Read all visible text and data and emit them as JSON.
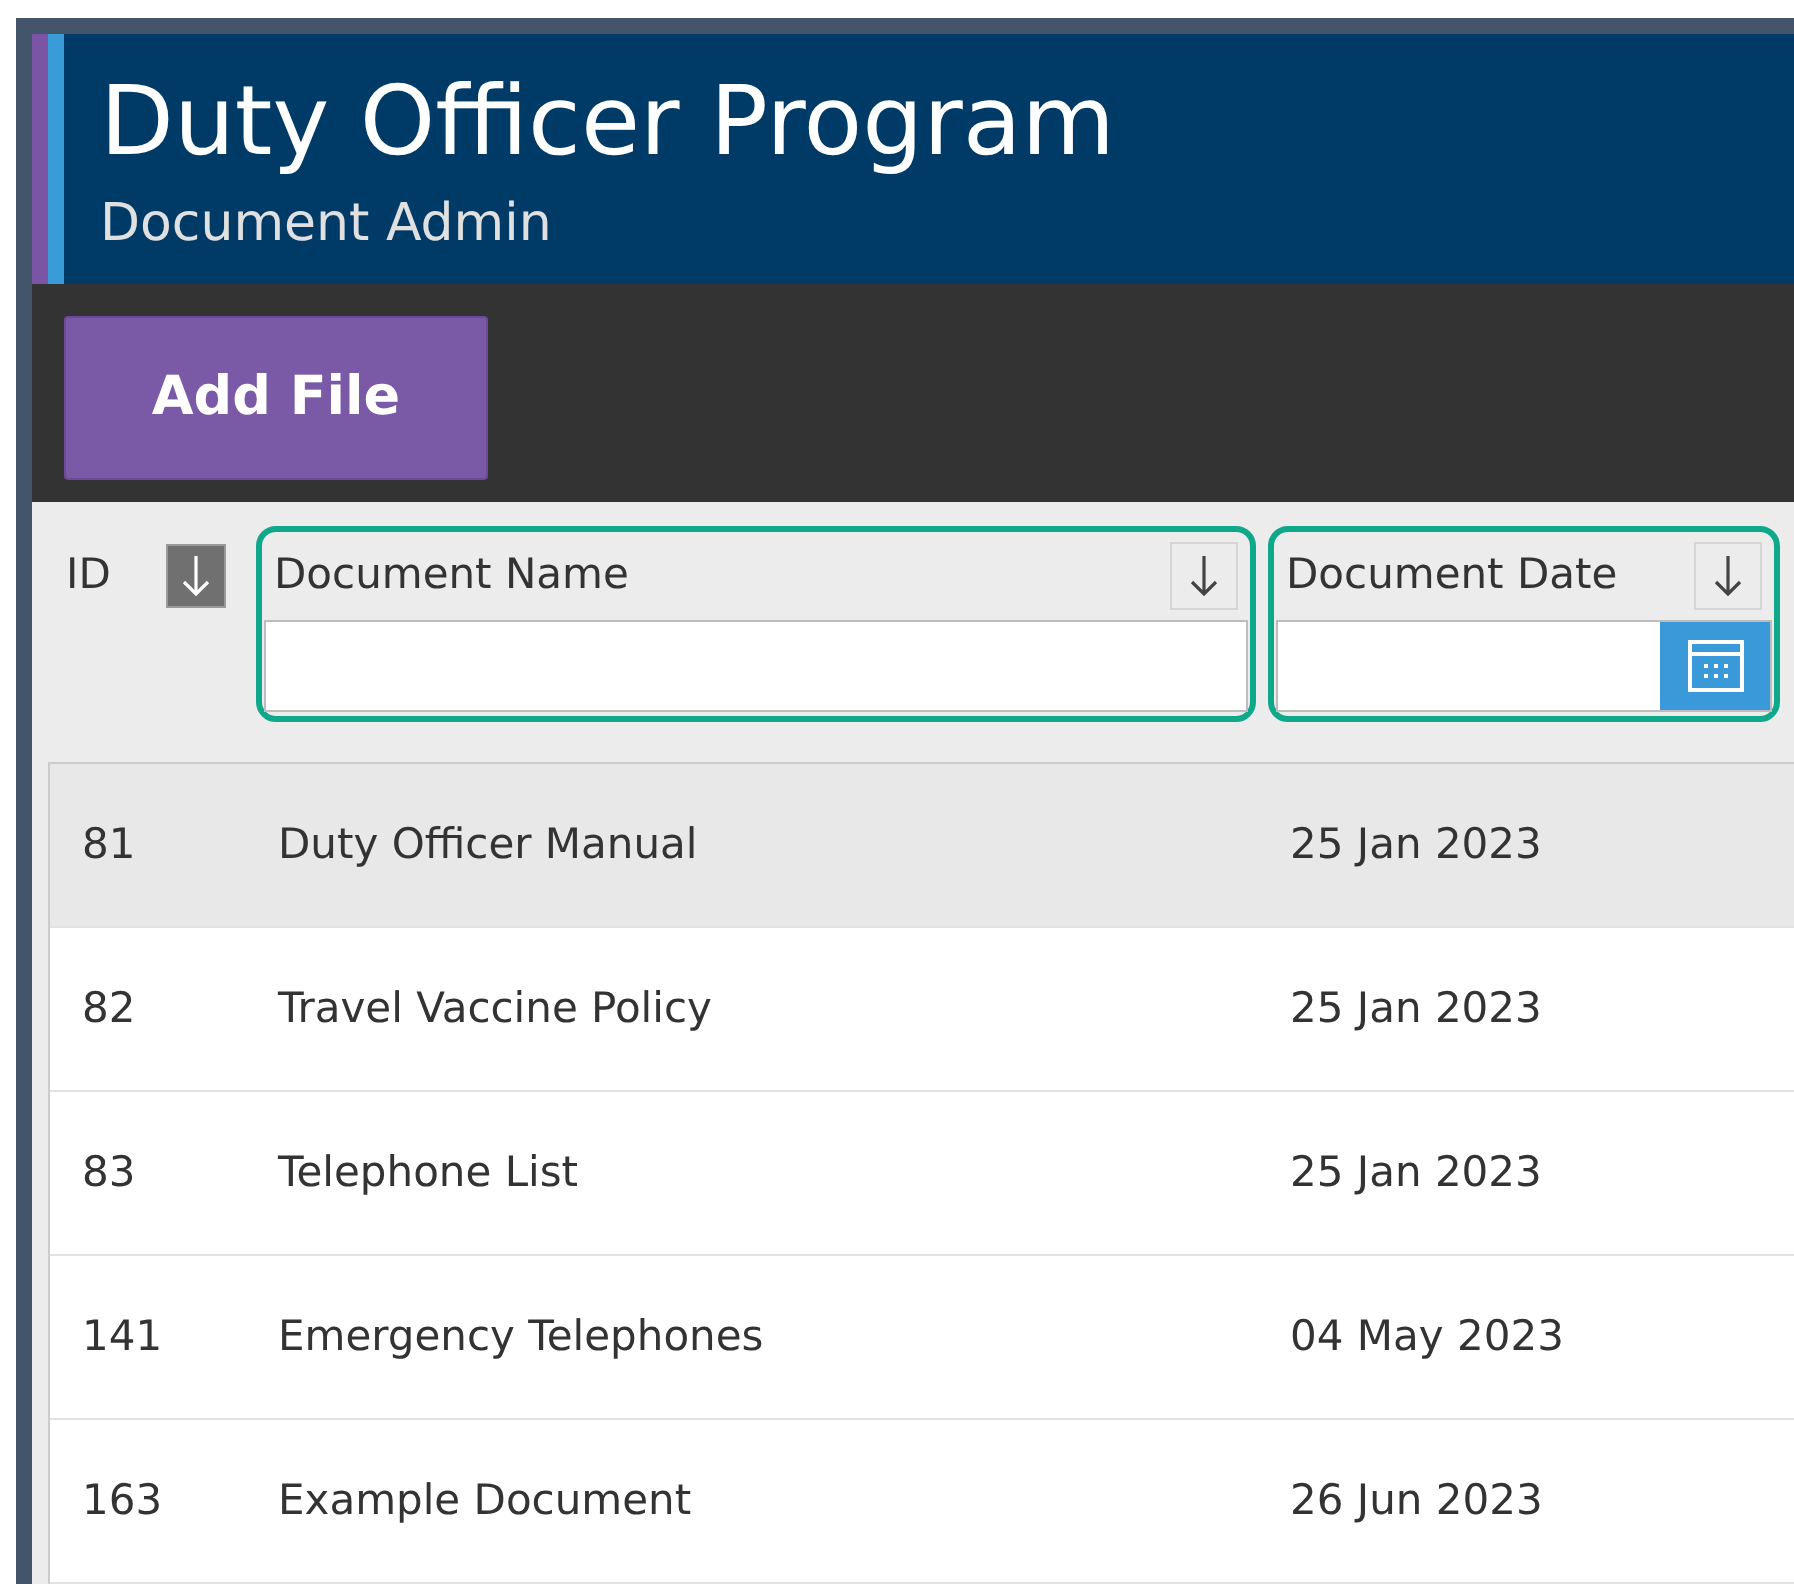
{
  "header": {
    "title": "Duty Officer Program",
    "subtitle": "Document Admin"
  },
  "toolbar": {
    "button": "Add File"
  },
  "table": {
    "columns": [
      {
        "label": "ID",
        "kind": "id",
        "sort_active": true,
        "highlighted": false
      },
      {
        "label": "Document Name",
        "kind": "text",
        "sort_active": false,
        "highlighted": true
      },
      {
        "label": "Document Date",
        "kind": "date",
        "sort_active": false,
        "highlighted": true
      }
    ],
    "rows": [
      {
        "cells": [
          "81",
          "Duty Officer Manual",
          "25 Jan 2023"
        ],
        "selected": true
      },
      {
        "cells": [
          "82",
          "Travel Vaccine Policy",
          "25 Jan 2023"
        ],
        "selected": false
      },
      {
        "cells": [
          "83",
          "Telephone List",
          "25 Jan 2023"
        ],
        "selected": false
      },
      {
        "cells": [
          "141",
          "Emergency Telephones",
          "04 May 2023"
        ],
        "selected": false
      },
      {
        "cells": [
          "163",
          "Example Document",
          "26 Jun 2023"
        ],
        "selected": false
      }
    ]
  }
}
